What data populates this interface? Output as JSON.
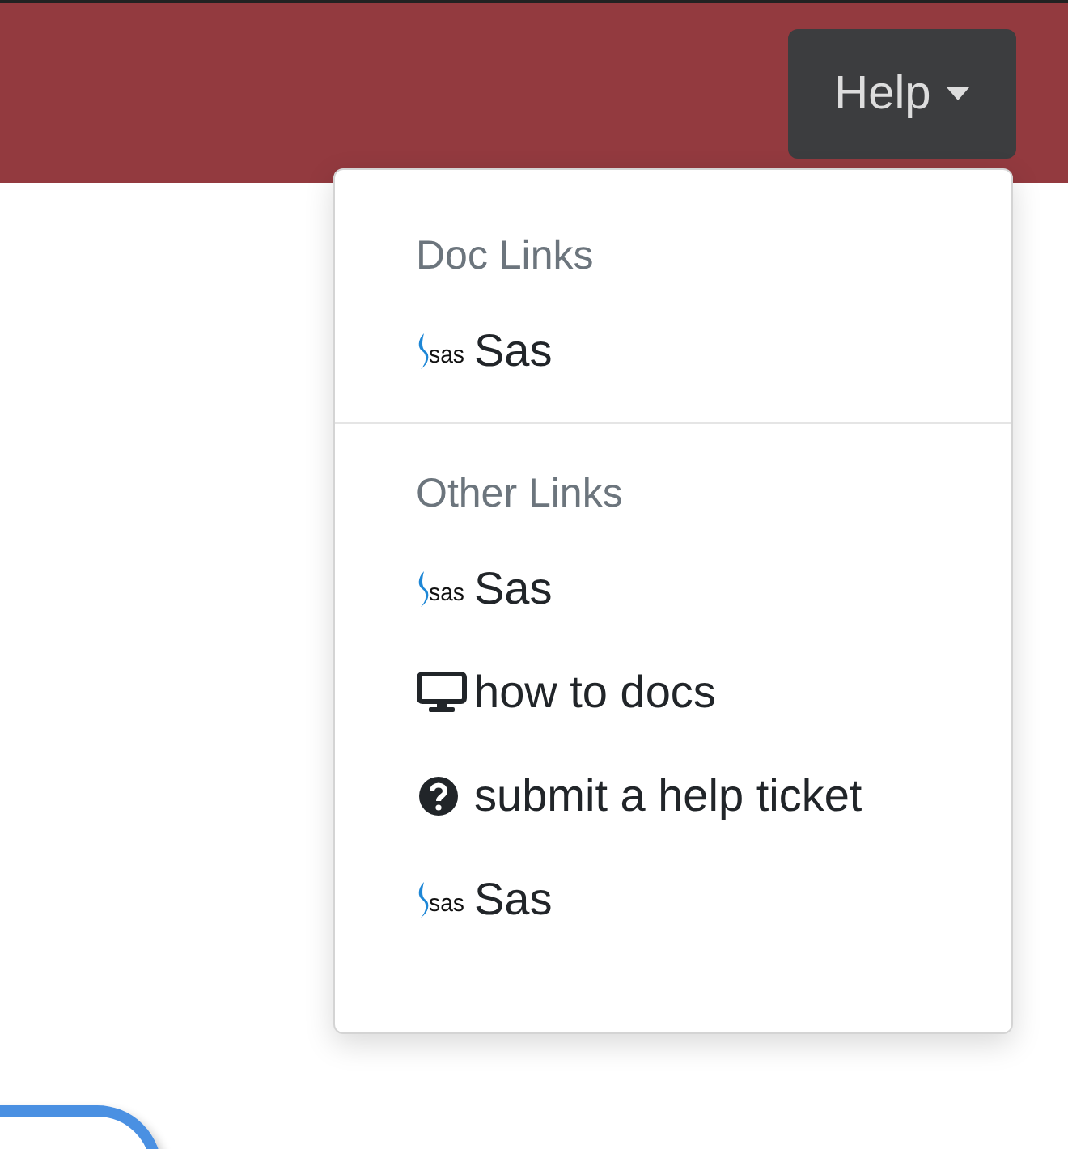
{
  "navbar": {
    "help_button": {
      "label": "Help",
      "expanded": true
    }
  },
  "dropdown": {
    "sections": [
      {
        "header": "Doc Links",
        "items": [
          {
            "kind": "logo",
            "logo_text": "sas",
            "label": "Sas"
          }
        ]
      },
      {
        "header": "Other Links",
        "items": [
          {
            "kind": "logo",
            "logo_text": "sas",
            "label": "Sas"
          },
          {
            "kind": "monitor",
            "label": "how to docs"
          },
          {
            "kind": "question",
            "label": "submit a help ticket"
          },
          {
            "kind": "logo",
            "logo_text": "sas",
            "label": "Sas"
          }
        ]
      }
    ]
  }
}
